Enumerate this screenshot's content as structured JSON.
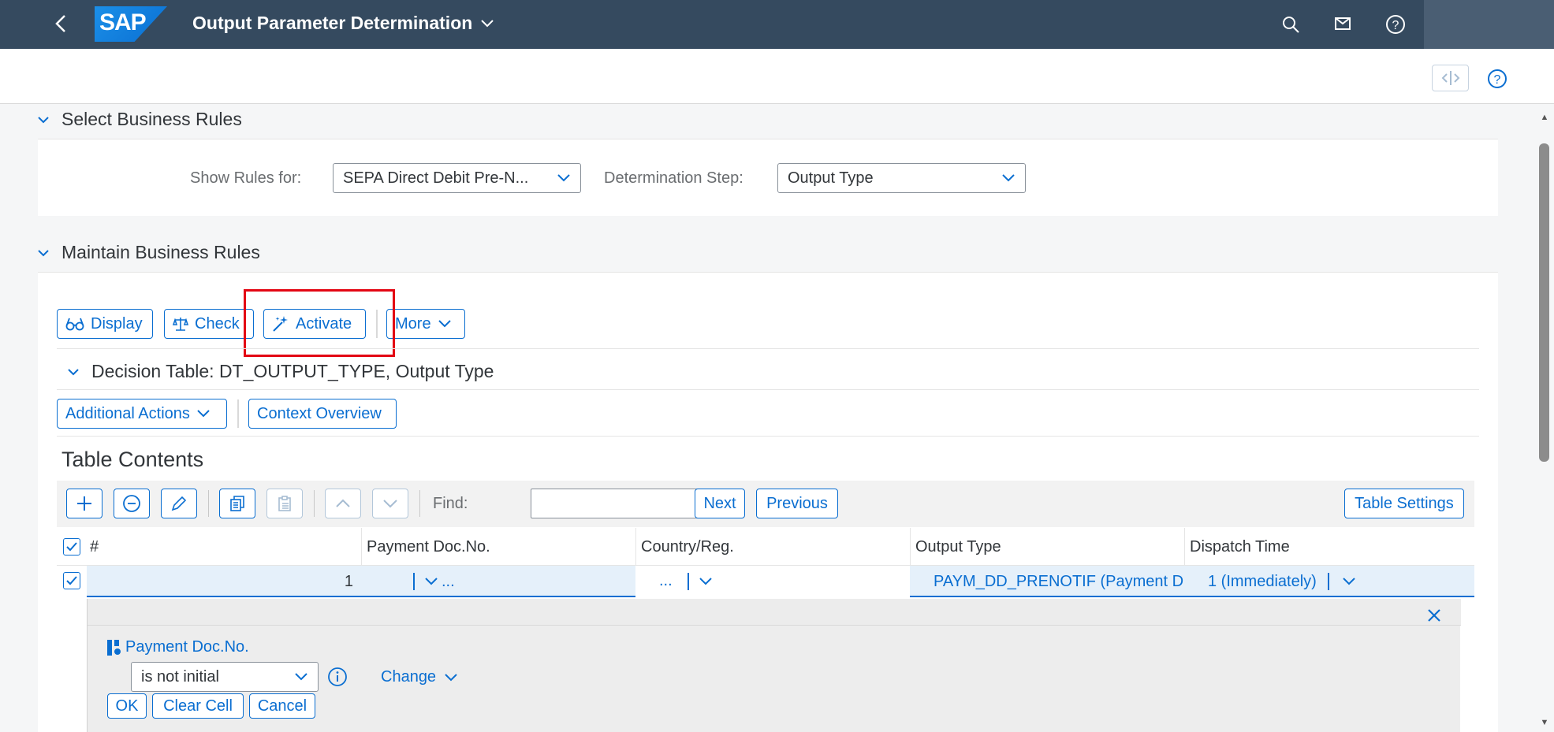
{
  "shell": {
    "title": "Output Parameter Determination",
    "logo_text": "SAP"
  },
  "sections": {
    "select": {
      "title": "Select Business Rules"
    },
    "maintain": {
      "title": "Maintain Business Rules"
    }
  },
  "filters": {
    "show_rules_label": "Show Rules for:",
    "show_rules_value": "SEPA Direct Debit Pre-N...",
    "step_label": "Determination Step:",
    "step_value": "Output Type"
  },
  "toolbar": {
    "display": "Display",
    "check": "Check",
    "activate": "Activate",
    "more": "More"
  },
  "decision_table": {
    "title": "Decision Table: DT_OUTPUT_TYPE, Output Type",
    "additional_actions": "Additional Actions",
    "context_overview": "Context Overview"
  },
  "table_contents": {
    "title": "Table Contents",
    "find_label": "Find:",
    "find_value": "",
    "next": "Next",
    "previous": "Previous",
    "settings": "Table Settings",
    "columns": [
      "#",
      "Payment Doc.No.",
      "Country/Reg.",
      "Output Type",
      "Dispatch Time"
    ],
    "row": {
      "num": "1",
      "payment_doc": "...",
      "country": "...",
      "output_type": "PAYM_DD_PRENOTIF (Payment D",
      "dispatch_time": "1 (Immediately)"
    }
  },
  "cell_editor": {
    "field": "Payment Doc.No.",
    "operator": "is not initial",
    "change": "Change",
    "ok": "OK",
    "clear": "Clear Cell",
    "cancel": "Cancel"
  },
  "colors": {
    "shell": "#354a5f",
    "accent": "#0a6ed1",
    "highlight": "#e30613"
  }
}
